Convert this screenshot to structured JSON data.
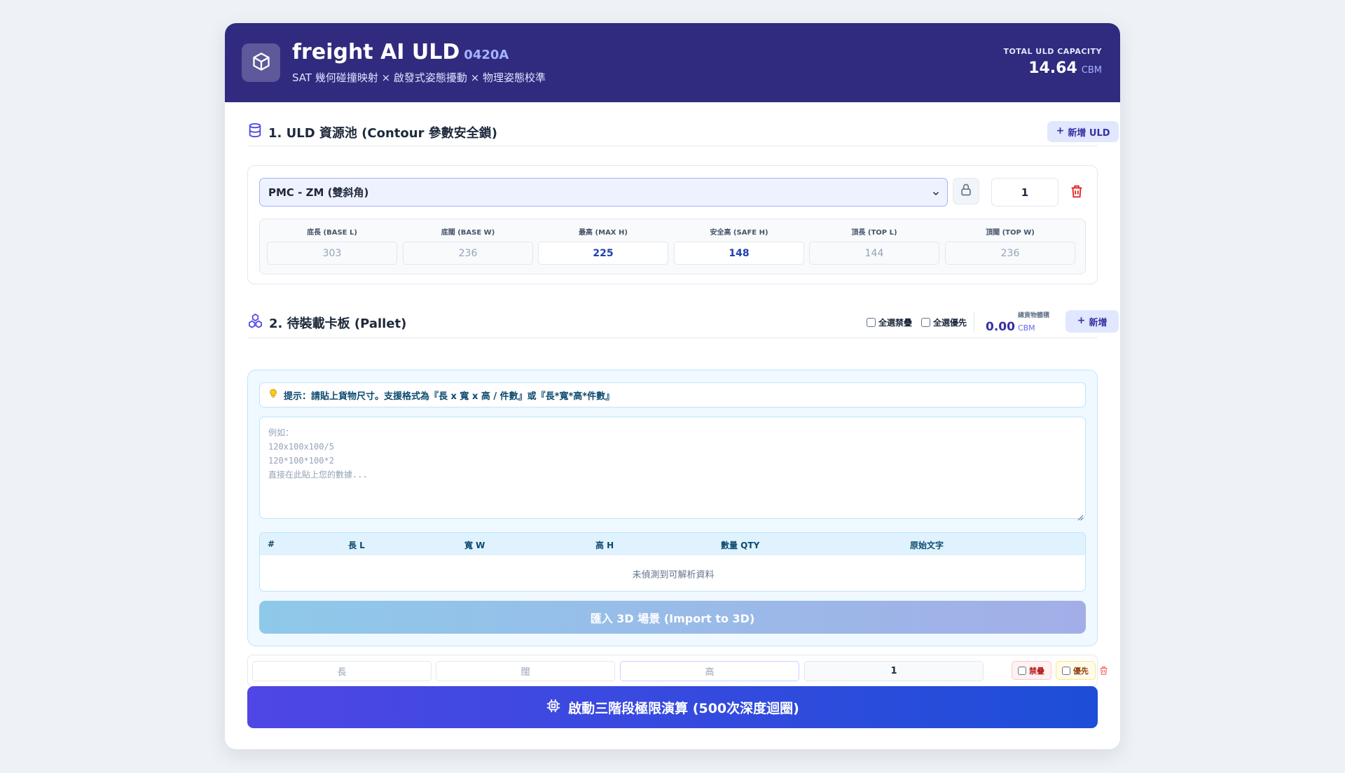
{
  "header": {
    "title": "freight AI ULD",
    "version": "0420A",
    "subtitle": "SAT 幾何碰撞映射 × 啟發式姿態擾動 × 物理姿態校準",
    "capacity_label": "TOTAL ULD CAPACITY",
    "capacity_value": "14.64",
    "capacity_unit": "CBM"
  },
  "uld_section": {
    "title": "1. ULD 資源池 (Contour 參數安全鎖)",
    "add_button": "新增 ULD",
    "selected_uld": "PMC - ZM (雙斜角)",
    "quantity": "1",
    "dims": [
      {
        "label": "底長 (BASE L)",
        "value": "303"
      },
      {
        "label": "底闊 (BASE W)",
        "value": "236"
      },
      {
        "label": "最高 (MAX H)",
        "value": "225"
      },
      {
        "label": "安全高 (SAFE H)",
        "value": "148"
      },
      {
        "label": "頂長 (TOP L)",
        "value": "144"
      },
      {
        "label": "頂闊 (TOP W)",
        "value": "236"
      }
    ]
  },
  "pallet_section": {
    "title": "2. 待裝載卡板 (Pallet)",
    "select_all_no_stack": "全選禁疊",
    "select_all_priority": "全選優先",
    "total_volume_label": "總貨物體積",
    "total_volume_value": "0.00",
    "total_volume_unit": "CBM",
    "add_button": "新增",
    "hint": "提示：請貼上貨物尺寸。支援格式為『長 x 寬 x 高 / 件數』或『長*寬*高*件數』",
    "paste_placeholder": "例如：\n120x100x100/5\n120*100*100*2\n直接在此貼上您的數據...",
    "table_headers": [
      "#",
      "長 L",
      "寬 W",
      "高 H",
      "數量 QTY",
      "原始文字"
    ],
    "empty_message": "未偵測到可解析資料",
    "import_button": "匯入 3D 場景 (Import to 3D)",
    "manual_row": {
      "length_placeholder": "長",
      "width_placeholder": "闊",
      "height_placeholder": "高",
      "quantity": "1",
      "no_stack_label": "禁疊",
      "priority_label": "優先"
    }
  },
  "run_button": "啟動三階段極限演算 (500次深度迴圈)",
  "colors": {
    "header_bg": "#302b7e",
    "accent": "#4f46e5",
    "run_gradient_end": "#1d4ed8",
    "danger": "#dc2626"
  },
  "icons": [
    "cube-icon",
    "database-icon",
    "lock-icon",
    "trash-icon",
    "boxes-icon",
    "plus-icon",
    "bulb-icon",
    "cpu-icon",
    "chevron-down-icon"
  ]
}
